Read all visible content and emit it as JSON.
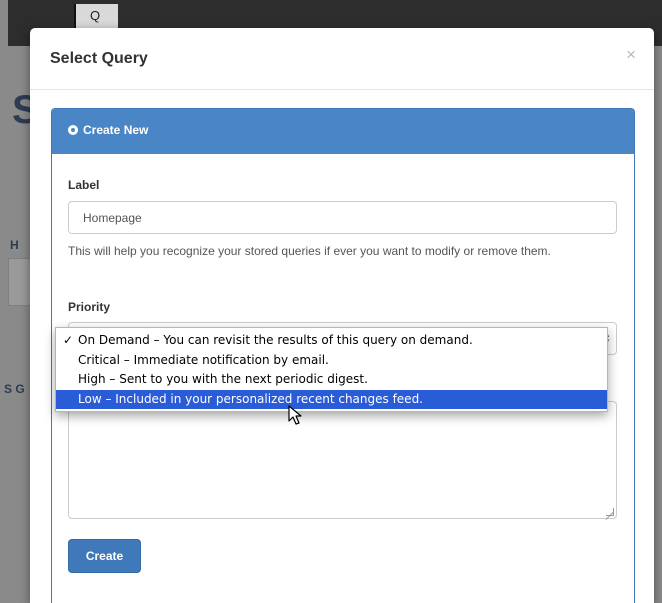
{
  "modal": {
    "title": "Select Query",
    "close_glyph": "×"
  },
  "panel": {
    "heading": "Create New"
  },
  "form": {
    "label_field": {
      "label": "Label",
      "value": "Homepage"
    },
    "help_text": "This will help you recognize your stored queries if ever you want to modify or remove them.",
    "priority": {
      "label": "Priority",
      "options": [
        {
          "text": "On Demand – You can revisit the results of this query on demand.",
          "checked": true
        },
        {
          "text": "Critical – Immediate notification by email.",
          "checked": false
        },
        {
          "text": "High – Sent to you with the next periodic digest.",
          "checked": false
        },
        {
          "text": "Low – Included in your personalized recent changes feed.",
          "checked": false,
          "highlighted": true
        }
      ]
    },
    "submit_label": "Create"
  },
  "background": {
    "search_glyph": "Q",
    "letters": [
      "S",
      "H",
      "S G"
    ]
  },
  "colors": {
    "panel_heading": "#4a86c5",
    "button": "#3f79ba",
    "dropdown_highlight": "#2b5cd8"
  },
  "icons": [
    "search-icon",
    "close-icon",
    "radio-icon",
    "select-arrows-icon",
    "checkmark-icon",
    "mouse-cursor-icon",
    "resize-grip-icon"
  ]
}
